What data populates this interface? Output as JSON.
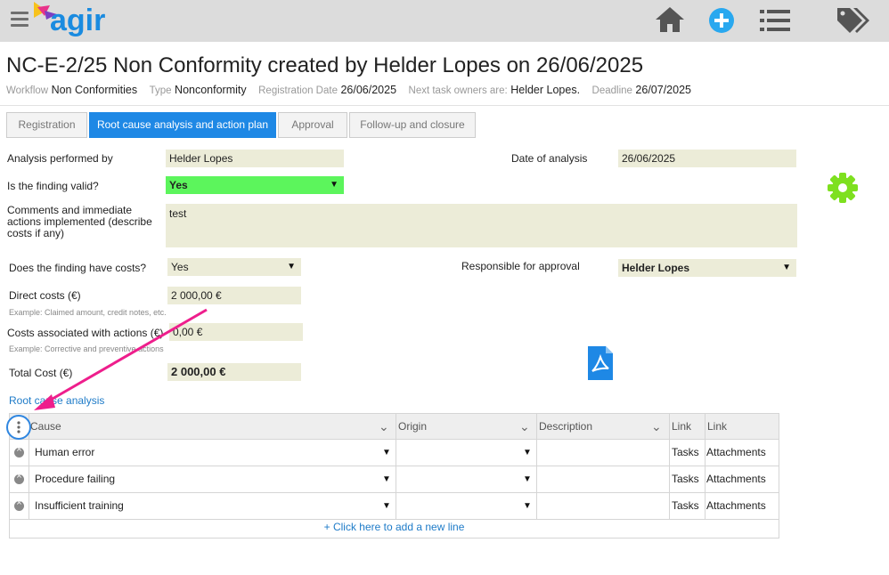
{
  "header": {
    "logo_text": "agir",
    "icons": [
      "menu-icon",
      "home-icon",
      "add-circle-icon",
      "list-icon",
      "tags-icon"
    ]
  },
  "page": {
    "title": "NC-E-2/25 Non Conformity created by Helder Lopes on 26/06/2025",
    "meta": {
      "workflow_label": "Workflow",
      "workflow_value": "Non Conformities",
      "type_label": "Type",
      "type_value": "Nonconformity",
      "regdate_label": "Registration Date",
      "regdate_value": "26/06/2025",
      "owners_label": "Next task owners are:",
      "owners_value": "Helder Lopes.",
      "deadline_label": "Deadline",
      "deadline_value": "26/07/2025"
    }
  },
  "tabs": [
    {
      "label": "Registration"
    },
    {
      "label": "Root cause analysis and action plan"
    },
    {
      "label": "Approval"
    },
    {
      "label": "Follow-up and closure"
    }
  ],
  "form": {
    "analysis_by_label": "Analysis performed by",
    "analysis_by_value": "Helder Lopes",
    "date_label": "Date of analysis",
    "date_value": "26/06/2025",
    "valid_label": "Is the finding valid?",
    "valid_value": "Yes",
    "comments_label_1": "Comments and immediate",
    "comments_label_2": "actions implemented (describe",
    "comments_label_3": "costs if any)",
    "comments_value": "test",
    "costs_label": "Does the finding have costs?",
    "costs_value": "Yes",
    "responsible_label": "Responsible for approval",
    "responsible_value": "Helder Lopes",
    "direct_label": "Direct costs (€)",
    "direct_value": "2 000,00 €",
    "direct_hint": "Example: Claimed amount, credit notes, etc.",
    "actions_label": "Costs associated with actions (€)",
    "actions_value": "0,00 €",
    "actions_hint": "Example: Corrective and preventive actions",
    "total_label": "Total Cost (€)",
    "total_value": "2 000,00 €"
  },
  "root_cause": {
    "link_label": "Root cause analysis",
    "columns": {
      "cause": "Cause",
      "origin": "Origin",
      "description": "Description",
      "link1": "Link",
      "link2": "Link"
    },
    "rows": [
      {
        "cause": "Human error",
        "tasks": "Tasks",
        "attachments": "Attachments"
      },
      {
        "cause": "Procedure failing",
        "tasks": "Tasks",
        "attachments": "Attachments"
      },
      {
        "cause": "Insufficient training",
        "tasks": "Tasks",
        "attachments": "Attachments"
      }
    ],
    "add_line": "+ Click here to add a new line"
  },
  "colors": {
    "accent": "#1e88e5",
    "valid_green": "#5cf55c",
    "gear_green": "#7ee01f",
    "field_bg": "#ececd8",
    "annotation_pink": "#ee1e8c"
  }
}
